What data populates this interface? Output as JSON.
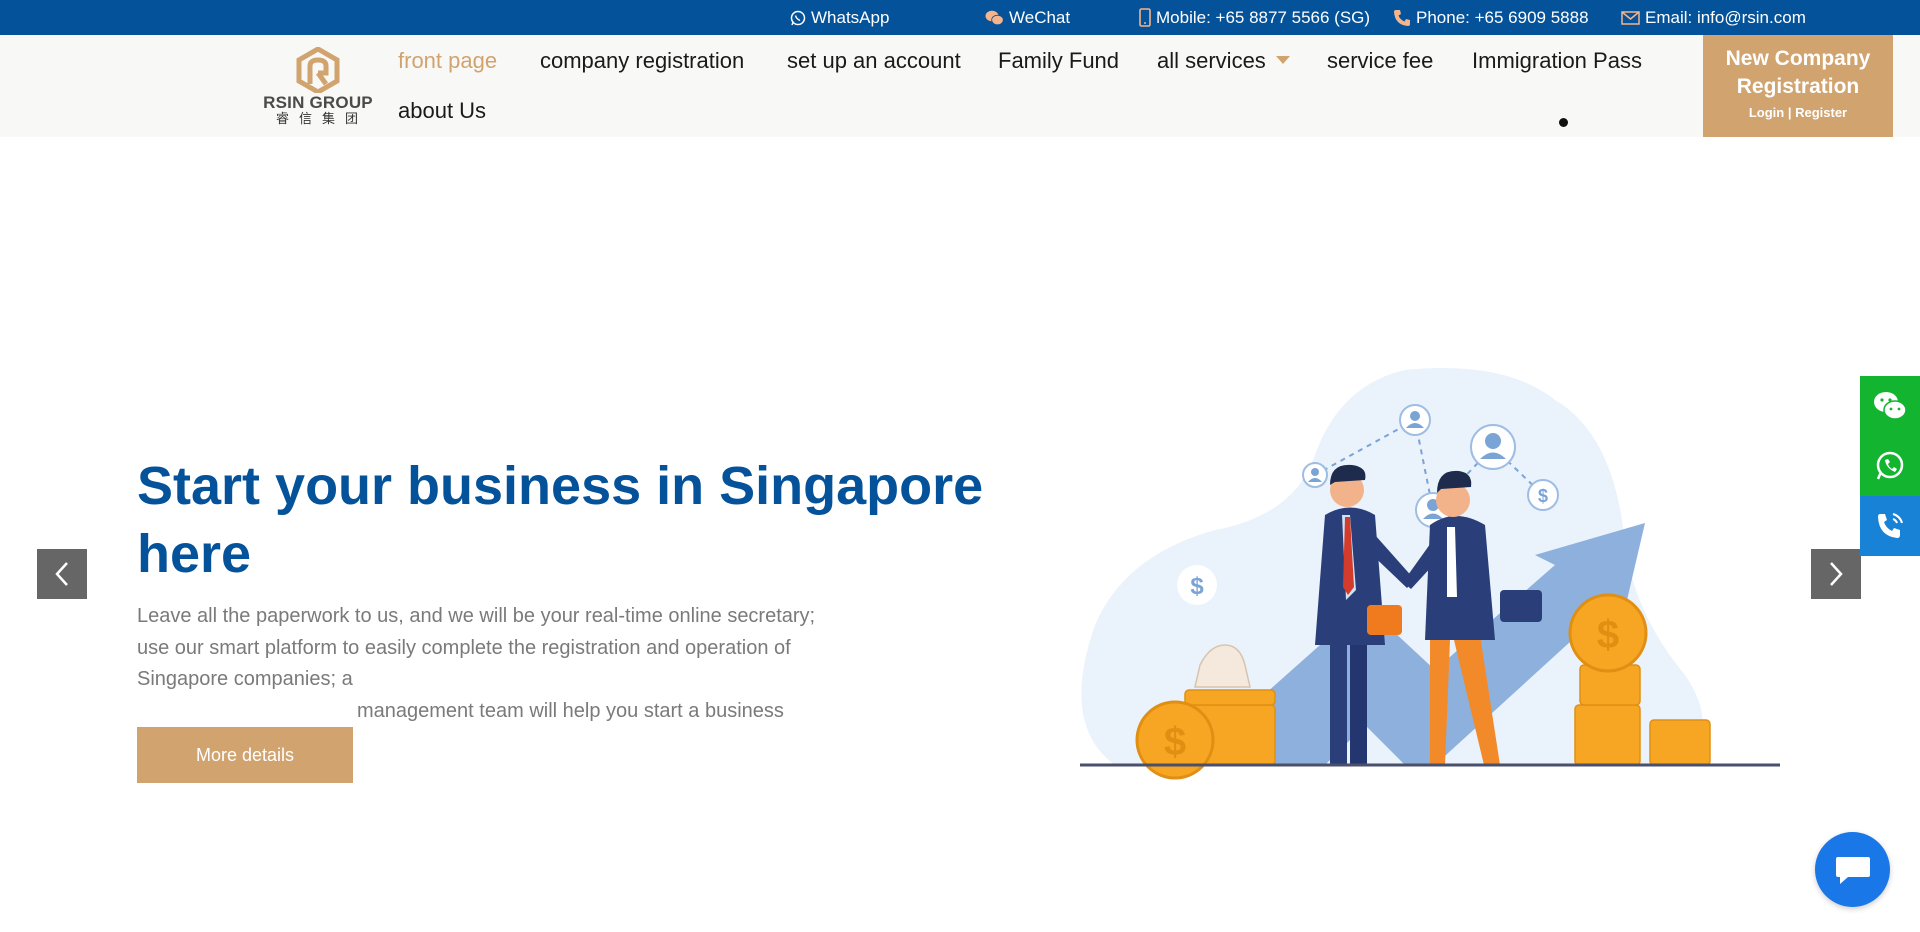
{
  "topbar": {
    "whatsapp": "WhatsApp",
    "wechat": "WeChat",
    "mobile": "Mobile: +65 8877 5566 (SG)",
    "phone": "Phone: +65 6909 5888",
    "email": "Email: info@rsin.com"
  },
  "logo": {
    "name": "RSIN GROUP",
    "chinese": "睿信集团"
  },
  "nav": {
    "items": [
      {
        "label": "front page",
        "active": true
      },
      {
        "label": "company registration"
      },
      {
        "label": "set up an account"
      },
      {
        "label": "Family Fund"
      },
      {
        "label": "all services",
        "dropdown": true
      },
      {
        "label": "service fee"
      },
      {
        "label": "Immigration Pass"
      },
      {
        "label": "about Us"
      }
    ]
  },
  "cta": {
    "title": "New Company Registration",
    "subtitle": "Login | Register"
  },
  "hero": {
    "title": "Start your business in Singapore here",
    "desc_lines": [
      "Leave all the paperwork to us, and we will be your real-time online secretary;",
      "use our smart platform to easily complete the registration and operation of Singapore companies; a",
      "management team will help you start a business"
    ],
    "button": "More details"
  },
  "colors": {
    "brand_blue": "#04529a",
    "accent_gold": "#d1a36f",
    "green": "#13b530",
    "phone_blue": "#1883d6",
    "chat_blue": "#1a77e8"
  },
  "icons": {
    "prev": "chevron-left-icon",
    "next": "chevron-right-icon",
    "side": [
      "wechat-icon",
      "whatsapp-icon",
      "phone-call-icon"
    ],
    "chat": "chat-bubble-icon"
  }
}
